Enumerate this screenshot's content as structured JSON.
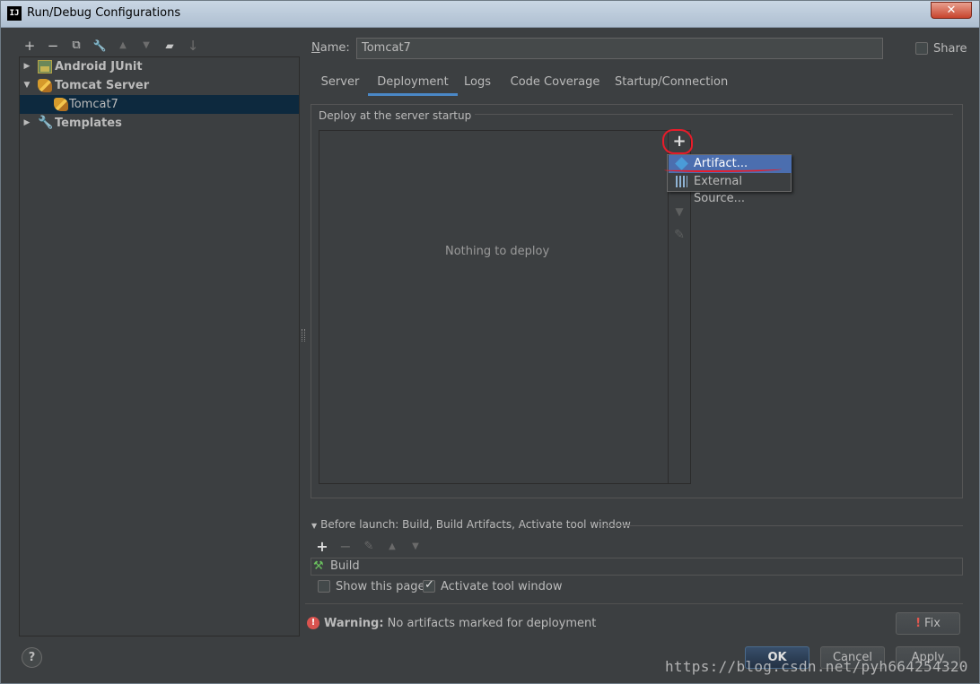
{
  "window": {
    "app_icon": "IJ",
    "title": "Run/Debug Configurations",
    "close_label": "✕"
  },
  "left_toolbar": {
    "icons": [
      "add-icon",
      "remove-icon",
      "copy-icon",
      "wrench-icon",
      "move-up-icon",
      "move-down-icon",
      "folder-icon",
      "sort-icon"
    ],
    "glyphs": {
      "add": "+",
      "remove": "−",
      "copy": "⧉",
      "wrench": "🔧",
      "up": "▲",
      "down": "▼",
      "folder": "▰",
      "sort": "↓"
    }
  },
  "tree": {
    "items": [
      {
        "label": "Android JUnit",
        "expanded": false,
        "icon": "junit-icon"
      },
      {
        "label": "Tomcat Server",
        "expanded": true,
        "icon": "tomcat-icon"
      },
      {
        "label": "Tomcat7",
        "child": true,
        "selected": true,
        "icon": "tomcat-icon"
      },
      {
        "label": "Templates",
        "expanded": false,
        "icon": "wrench-icon"
      }
    ],
    "arrow_collapsed": "▶",
    "arrow_expanded": "▼"
  },
  "name_field": {
    "label_prefix": "N",
    "label_rest": "ame:",
    "value": "Tomcat7"
  },
  "share": {
    "label": "Share",
    "checked": false
  },
  "tabs": [
    "Server",
    "Deployment",
    "Logs",
    "Code Coverage",
    "Startup/Connection"
  ],
  "active_tab": "Deployment",
  "deployment": {
    "group_title": "Deploy at the server startup",
    "empty_text": "Nothing to deploy",
    "add_glyph": "+",
    "down_glyph": "▼",
    "edit_glyph": "✎"
  },
  "add_popup": {
    "items": [
      "Artifact...",
      "External Source..."
    ],
    "selected": "Artifact..."
  },
  "before_launch": {
    "title": "Before launch: Build, Build Artifacts, Activate tool window",
    "toolbar": [
      "+",
      "−",
      "✎",
      "▲",
      "▼"
    ],
    "tasks": [
      {
        "label": "Build",
        "icon": "hammer-icon"
      }
    ],
    "hammer_glyph": "⚒"
  },
  "options": {
    "show_this_page": {
      "label": "Show this page",
      "checked": false
    },
    "activate_tool_window": {
      "label": "Activate tool window",
      "checked": true
    }
  },
  "warning": {
    "icon_glyph": "!",
    "bold": "Warning:",
    "text": " No artifacts marked for deployment"
  },
  "buttons": {
    "fix": "Fix",
    "fix_glyph": "!",
    "ok": "OK",
    "cancel": "Cancel",
    "apply": "Apply",
    "help": "?"
  },
  "watermark": "https://blog.csdn.net/pyh664254320",
  "colors": {
    "background": "#3c3f41",
    "selection": "#0d293e",
    "popup_selection": "#4b6eaf",
    "tab_underline": "#4a88c7",
    "annotation_red": "#e81c2a"
  }
}
